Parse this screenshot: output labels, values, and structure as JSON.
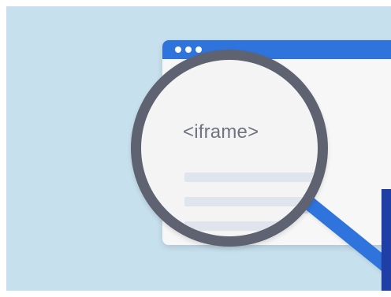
{
  "illustration": {
    "lens_text": "<iframe>",
    "palette": {
      "background": "#c7e0ee",
      "window_bar": "#2f74dc",
      "lens_ring": "#5e6271",
      "lens_fill": "#f4f4f4",
      "content_lines": "#d8dee9",
      "dark_accent": "#1f3fa6"
    },
    "icons": [
      "browser-window-icon",
      "magnifying-glass-icon"
    ]
  }
}
